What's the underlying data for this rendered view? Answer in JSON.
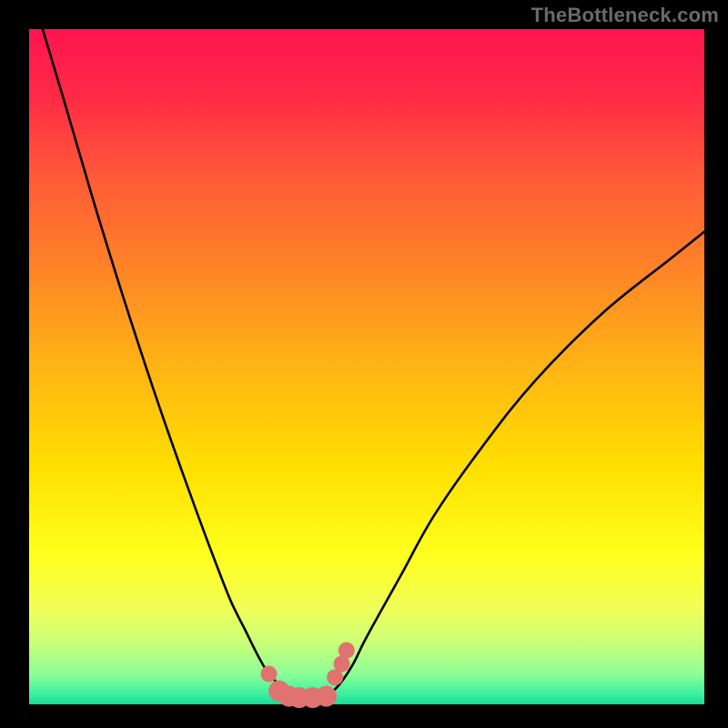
{
  "watermark": "TheBottleneck.com",
  "plot": {
    "inner_x": 32,
    "inner_y": 32,
    "inner_w": 742,
    "inner_h": 742
  },
  "gradient_stops": [
    {
      "offset": 0.0,
      "color": "#ff1450"
    },
    {
      "offset": 0.1,
      "color": "#ff2a46"
    },
    {
      "offset": 0.22,
      "color": "#ff5a38"
    },
    {
      "offset": 0.35,
      "color": "#ff8228"
    },
    {
      "offset": 0.5,
      "color": "#ffb414"
    },
    {
      "offset": 0.65,
      "color": "#ffe000"
    },
    {
      "offset": 0.78,
      "color": "#ffff1e"
    },
    {
      "offset": 0.86,
      "color": "#f0ff5a"
    },
    {
      "offset": 0.91,
      "color": "#c8ff78"
    },
    {
      "offset": 0.955,
      "color": "#8cff96"
    },
    {
      "offset": 0.985,
      "color": "#3cf0a0"
    },
    {
      "offset": 1.0,
      "color": "#14dc96"
    }
  ],
  "chart_data": {
    "type": "line",
    "title": "",
    "xlabel": "",
    "ylabel": "",
    "xlim": [
      0,
      100
    ],
    "ylim": [
      0,
      100
    ],
    "series": [
      {
        "name": "left-curve",
        "x": [
          2,
          5,
          10,
          15,
          20,
          25,
          28,
          30,
          32,
          34,
          35.5,
          37,
          38.5,
          40
        ],
        "values": [
          100,
          90,
          73,
          57,
          42,
          28,
          20,
          15,
          11,
          7,
          4.5,
          3,
          1.8,
          1
        ]
      },
      {
        "name": "right-curve",
        "x": [
          44,
          46,
          48,
          50,
          55,
          60,
          67,
          75,
          85,
          95,
          100
        ],
        "values": [
          1,
          3,
          6,
          10,
          19,
          28,
          38,
          48,
          58,
          66,
          70
        ]
      }
    ],
    "optimal_markers": {
      "comment": "pink U-shaped marker cluster near curve minimum",
      "x": [
        35.5,
        37,
        38.5,
        40,
        42,
        44,
        45.3,
        46.3,
        47
      ],
      "values": [
        4.5,
        2.0,
        1.2,
        1.0,
        1.0,
        1.2,
        4.0,
        6.0,
        8.0
      ],
      "radius_primary": 11.5,
      "radius_secondary": 9,
      "color": "#e0736f"
    }
  }
}
